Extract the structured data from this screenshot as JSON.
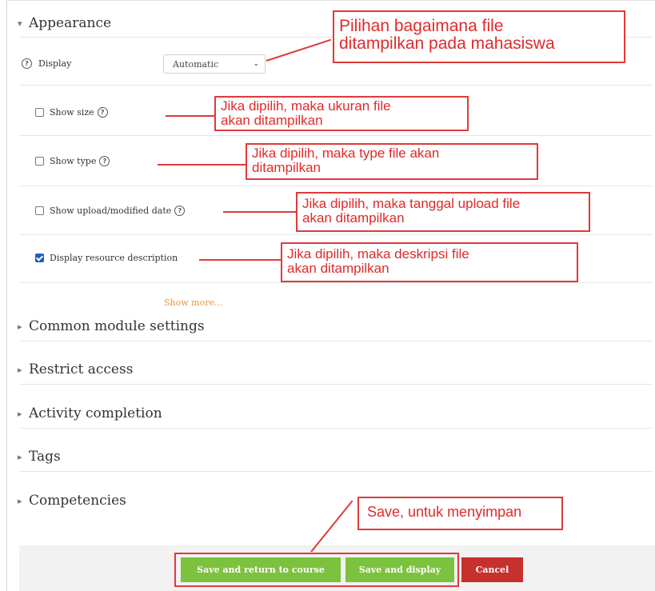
{
  "sections": {
    "appearance": "Appearance",
    "common_module_settings": "Common module settings",
    "restrict_access": "Restrict access",
    "activity_completion": "Activity completion",
    "tags": "Tags",
    "competencies": "Competencies"
  },
  "display": {
    "label": "Display",
    "selected": "Automatic"
  },
  "options": {
    "show_size": {
      "label": "Show size",
      "checked": false
    },
    "show_type": {
      "label": "Show type",
      "checked": false
    },
    "show_date": {
      "label": "Show upload/modified date",
      "checked": false
    },
    "show_description": {
      "label": "Display resource description",
      "checked": true
    }
  },
  "show_more": "Show more...",
  "buttons": {
    "save_return": "Save and return to course",
    "save_display": "Save and display",
    "cancel": "Cancel"
  },
  "annotations": {
    "display": [
      "Pilihan bagaimana file",
      "ditampilkan pada mahasiswa"
    ],
    "show_size": [
      "Jika dipilih, maka ukuran file",
      "akan ditampilkan"
    ],
    "show_type": [
      "Jika dipilih, maka type file akan",
      "ditampilkan"
    ],
    "show_date": [
      "Jika dipilih, maka tanggal upload file",
      "akan ditampilkan"
    ],
    "show_description": [
      "Jika dipilih, maka deskripsi file",
      "akan ditampilkan"
    ],
    "save": [
      "Save, untuk menyimpan"
    ]
  },
  "colors": {
    "annotation_red": "#e03a3a",
    "save_green": "#7cc23e",
    "cancel_red": "#c6302d",
    "show_more_orange": "#f0943a",
    "checkbox_blue": "#1e5fbf"
  }
}
